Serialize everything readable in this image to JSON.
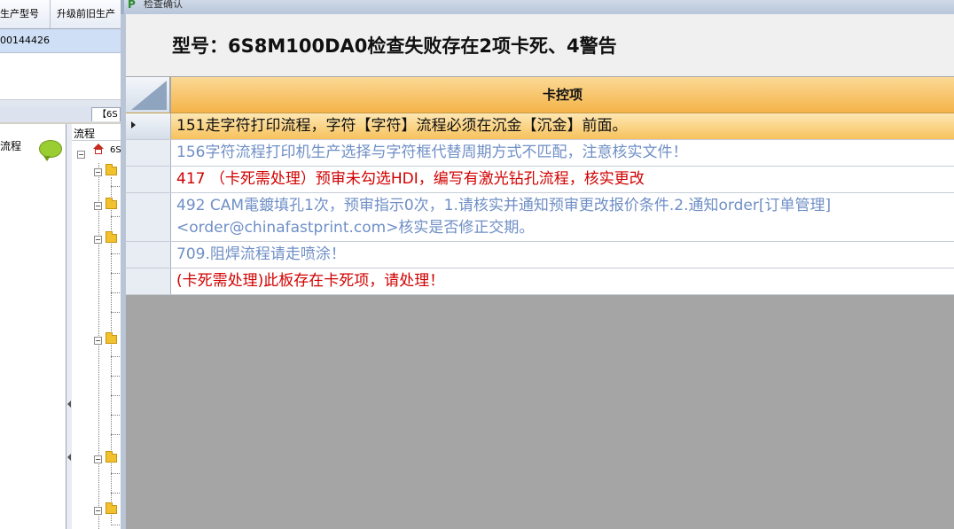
{
  "background_app": {
    "grid_headers": [
      "生产型号",
      "升级前旧生产"
    ],
    "grid_row_value": "00144426",
    "tab_label": "【6S",
    "left_panel_label": "流程",
    "tree_panel_label": "流程",
    "tree_root_label": "6S"
  },
  "dialog": {
    "title": "检查确认",
    "heading": "型号：6S8M100DA0检查失败存在2项卡死、4警告",
    "column_header": "卡控项",
    "rows": [
      {
        "text": "151走字符打印流程，字符【字符】流程必须在沉金【沉金】前面。",
        "color": "#111111"
      },
      {
        "text": "156字符流程打印机生产选择与字符框代替周期方式不匹配，注意核实文件！",
        "color": "#6f8fc6"
      },
      {
        "text": "417 （卡死需处理）预审未勾选HDI，编写有激光钻孔流程，核实更改",
        "color": "#d10000"
      },
      {
        "text": "492 CAM電鍍填孔1次，预审指示0次，1.请核实并通知预审更改报价条件.2.通知order[订单管理]<order@chinafastprint.com>核实是否修正交期。",
        "color": "#6f8fc6"
      },
      {
        "text": "709.阻焊流程请走喷涂！",
        "color": "#6f8fc6"
      },
      {
        "text": "(卡死需处理)此板存在卡死项，请处理！",
        "color": "#d10000"
      }
    ],
    "selected_row": 0
  }
}
